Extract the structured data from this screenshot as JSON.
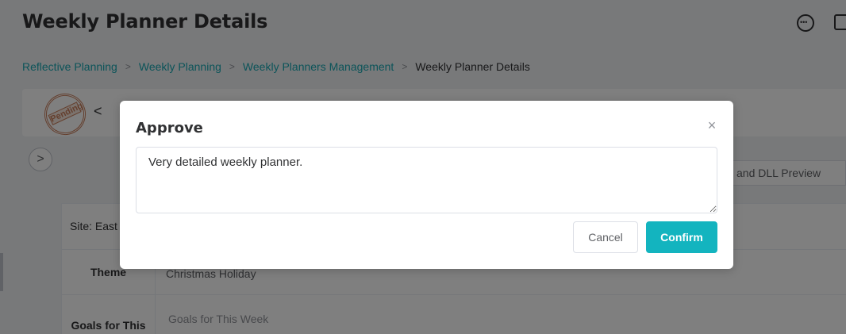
{
  "page": {
    "title": "Weekly Planner Details"
  },
  "header_icons": {
    "chat": "chat-bubble-icon",
    "notes": "notes-icon"
  },
  "breadcrumb": {
    "items": [
      "Reflective Planning",
      "Weekly Planning",
      "Weekly Planners Management",
      "Weekly Planner Details"
    ],
    "separator": ">"
  },
  "toolbar": {
    "status_stamp": "Pending",
    "back_icon": "<"
  },
  "expand_button": ">",
  "tab_strip": {
    "label": "and DLL Preview"
  },
  "table": {
    "site_label": "Site: East",
    "theme_label": "Theme",
    "theme_value": "Christmas Holiday",
    "goals_label": "Goals for This",
    "goals_placeholder": "Goals for This Week"
  },
  "dialog": {
    "title": "Approve",
    "close_icon": "×",
    "comment_value": "Very detailed weekly planner.",
    "cancel_label": "Cancel",
    "confirm_label": "Confirm"
  },
  "colors": {
    "accent": "#13b4bf",
    "link": "#18a8b3",
    "overlay": "rgba(0,0,0,0.5)"
  }
}
